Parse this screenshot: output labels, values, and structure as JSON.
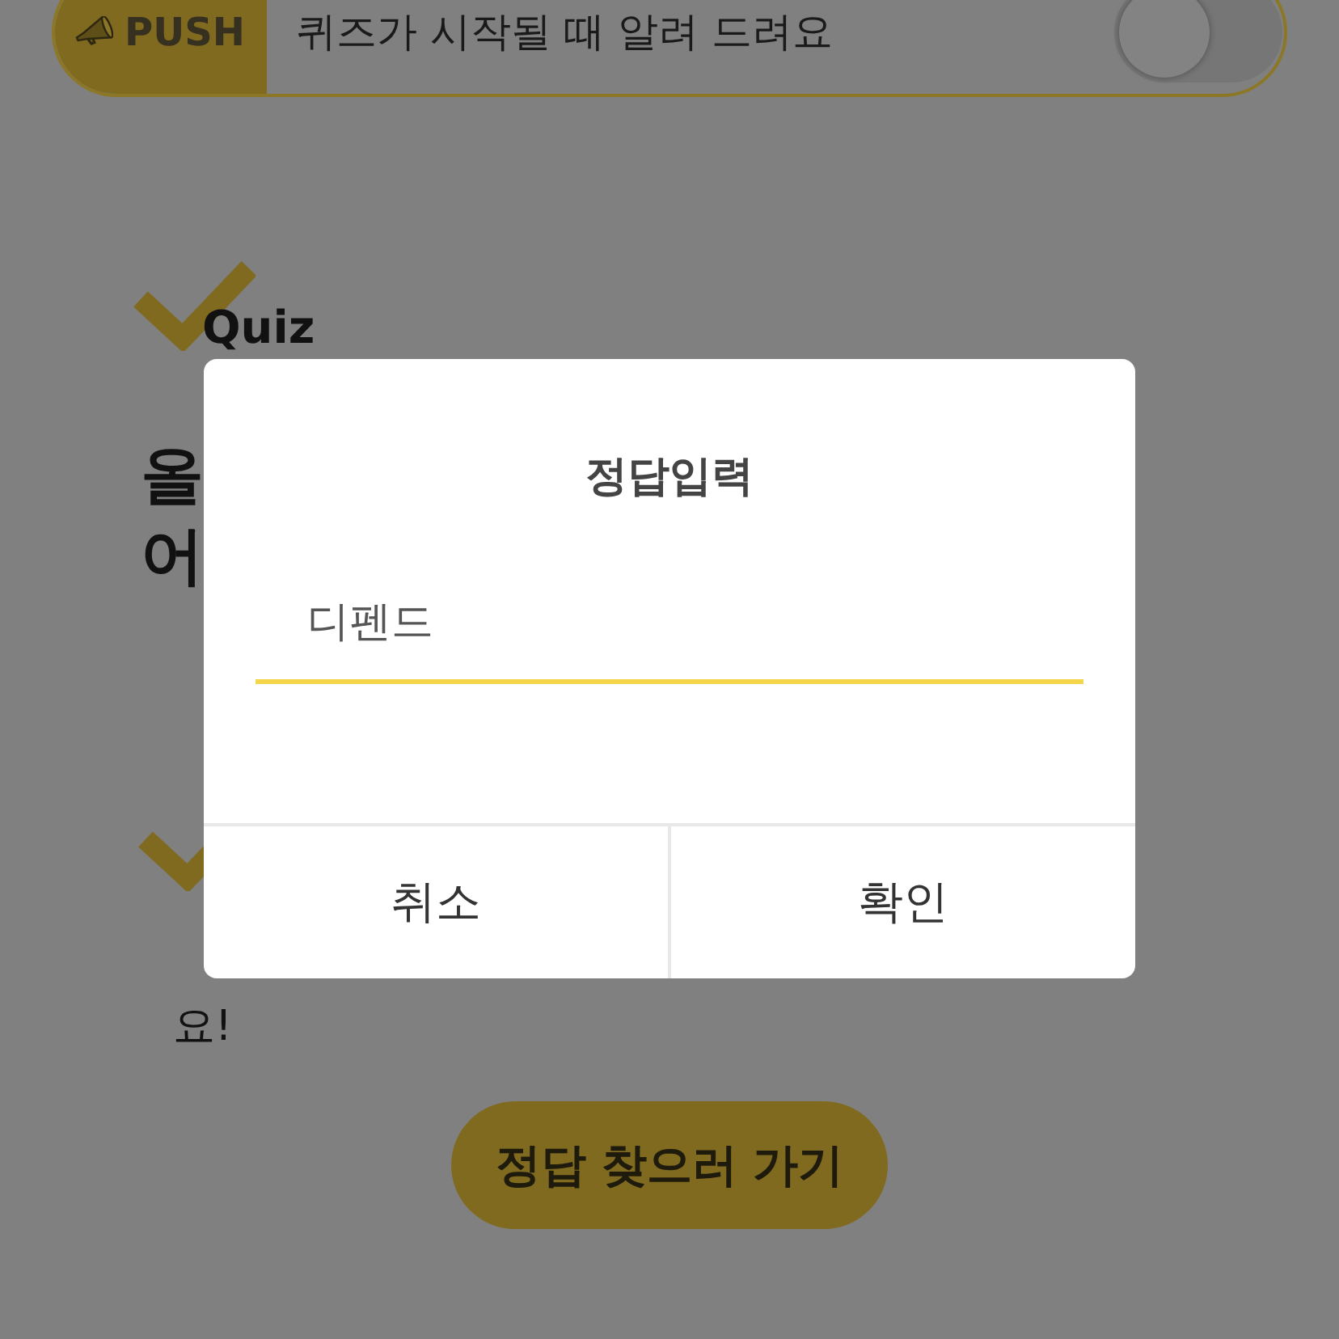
{
  "push_bar": {
    "badge": "PUSH",
    "message": "퀴즈가 시작될 때 알려 드려요",
    "toggle": {
      "on": false
    }
  },
  "quiz_section": {
    "heading": "Quiz",
    "title_lines": [
      "올",
      "어"
    ]
  },
  "info_section": {
    "visible_text": "요!"
  },
  "find_answer_button": "정답 찾으러 가기",
  "dialog": {
    "title": "정답입력",
    "answer_field": {
      "value": "디펜드"
    },
    "buttons": [
      "취소",
      "확인"
    ]
  }
}
